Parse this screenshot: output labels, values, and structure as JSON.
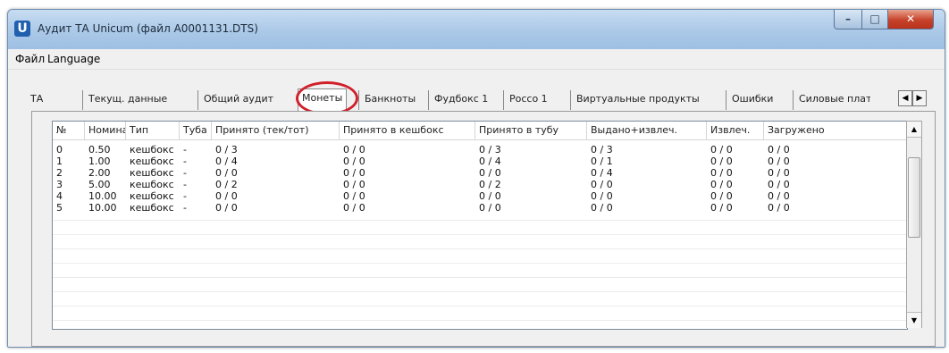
{
  "window": {
    "title": "Аудит ТА Unicum (файл A0001131.DTS)",
    "app_icon_letter": "U",
    "buttons": {
      "minimize": "–",
      "maximize": "□",
      "close": "✕"
    }
  },
  "menu": [
    "Файл",
    "Language"
  ],
  "tabs": [
    {
      "label": "ТА"
    },
    {
      "label": "Текущ. данные"
    },
    {
      "label": "Общий аудит"
    },
    {
      "label": "Монеты",
      "active": true
    },
    {
      "label": "Банкноты"
    },
    {
      "label": "Фудбокс 1"
    },
    {
      "label": "Россо 1"
    },
    {
      "label": "Виртуальные продукты"
    },
    {
      "label": "Ошибки"
    },
    {
      "label": "Силовые плат"
    }
  ],
  "tab_scroll": {
    "left": "◀",
    "right": "▶"
  },
  "table": {
    "columns": [
      "№",
      "Номинал",
      "Тип",
      "Туба",
      "Принято (тек/тот)",
      "Принято в кешбокс",
      "Принято в тубу",
      "Выдано+извлеч.",
      "Извлеч.",
      "Загружено"
    ],
    "rows": [
      [
        "0",
        "0.50",
        "кешбокс",
        "-",
        "0 / 3",
        "0 / 0",
        "0 / 3",
        "0 / 3",
        "0 / 0",
        "0 / 0"
      ],
      [
        "1",
        "1.00",
        "кешбокс",
        "-",
        "0 / 4",
        "0 / 0",
        "0 / 4",
        "0 / 1",
        "0 / 0",
        "0 / 0"
      ],
      [
        "2",
        "2.00",
        "кешбокс",
        "-",
        "0 / 0",
        "0 / 0",
        "0 / 0",
        "0 / 4",
        "0 / 0",
        "0 / 0"
      ],
      [
        "3",
        "5.00",
        "кешбокс",
        "-",
        "0 / 2",
        "0 / 0",
        "0 / 2",
        "0 / 0",
        "0 / 0",
        "0 / 0"
      ],
      [
        "4",
        "10.00",
        "кешбокс",
        "-",
        "0 / 0",
        "0 / 0",
        "0 / 0",
        "0 / 0",
        "0 / 0",
        "0 / 0"
      ],
      [
        "5",
        "10.00",
        "кешбокс",
        "-",
        "0 / 0",
        "0 / 0",
        "0 / 0",
        "0 / 0",
        "0 / 0",
        "0 / 0"
      ]
    ]
  },
  "scrollbar": {
    "up": "▲",
    "down": "▼"
  },
  "colors": {
    "highlight_circle": "#d0202a",
    "title_bar": "#a9c7e7"
  }
}
